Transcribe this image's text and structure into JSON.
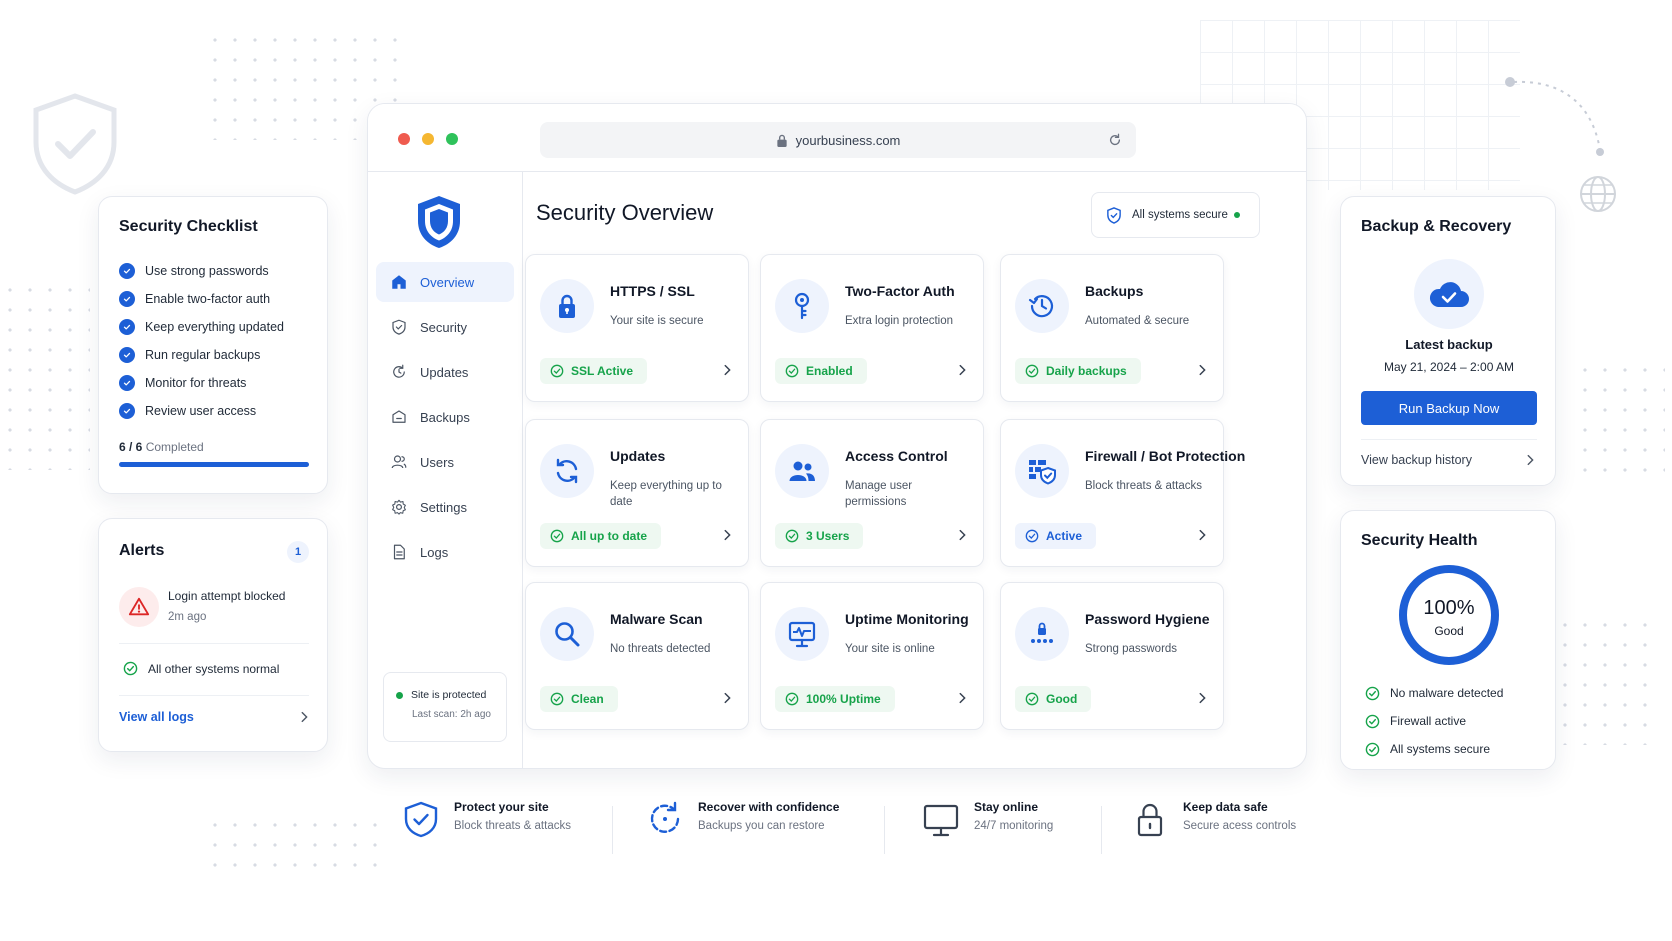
{
  "browser": {
    "url": "yourbusiness.com"
  },
  "sidebar": {
    "items": [
      {
        "label": "Overview",
        "icon": "home-icon",
        "active": true
      },
      {
        "label": "Security",
        "icon": "shield-icon"
      },
      {
        "label": "Updates",
        "icon": "refresh-icon"
      },
      {
        "label": "Backups",
        "icon": "box-icon"
      },
      {
        "label": "Users",
        "icon": "user-icon"
      },
      {
        "label": "Settings",
        "icon": "gear-icon"
      },
      {
        "label": "Logs",
        "icon": "document-icon"
      }
    ],
    "status": {
      "title": "Site is protected",
      "subtitle": "Last scan: 2h ago"
    }
  },
  "main": {
    "title": "Security Overview",
    "status_badge": "All systems secure",
    "tiles": [
      {
        "title": "HTTPS / SSL",
        "subtitle": "Your site is secure",
        "pill": "SSL Active",
        "icon": "lock-icon"
      },
      {
        "title": "Two-Factor Auth",
        "subtitle": "Extra login protection",
        "pill": "Enabled",
        "icon": "key-icon"
      },
      {
        "title": "Backups",
        "subtitle": "Automated & secure",
        "pill": "Daily backups",
        "icon": "history-icon"
      },
      {
        "title": "Updates",
        "subtitle": "Keep everything up to date",
        "pill": "All up to date",
        "icon": "sync-icon"
      },
      {
        "title": "Access Control",
        "subtitle": "Manage user permissions",
        "pill": "3 Users",
        "icon": "users-icon"
      },
      {
        "title": "Firewall / Bot Protection",
        "subtitle": "Block threats & attacks",
        "pill": "Active",
        "icon": "firewall-icon"
      },
      {
        "title": "Malware Scan",
        "subtitle": "No threats detected",
        "pill": "Clean",
        "icon": "search-icon"
      },
      {
        "title": "Uptime Monitoring",
        "subtitle": "Your site is online",
        "pill": "100% Uptime",
        "icon": "monitor-icon"
      },
      {
        "title": "Password Hygiene",
        "subtitle": "Strong passwords",
        "pill": "Good",
        "icon": "password-icon"
      }
    ]
  },
  "checklist": {
    "title": "Security Checklist",
    "items": [
      "Use strong passwords",
      "Enable two-factor auth",
      "Keep everything updated",
      "Run regular backups",
      "Monitor for threats",
      "Review user access"
    ],
    "progress_count": "6 / 6",
    "progress_label": "Completed",
    "progress": 1.0
  },
  "alerts": {
    "title": "Alerts",
    "count": "1",
    "alert_title": "Login attempt blocked",
    "alert_time": "2m ago",
    "normal": "All other systems normal",
    "link": "View all logs"
  },
  "backup": {
    "title": "Backup & Recovery",
    "latest_label": "Latest backup",
    "latest_date": "May 21, 2024 – 2:00 AM",
    "button": "Run Backup Now",
    "history_link": "View backup history"
  },
  "health": {
    "title": "Security Health",
    "percent": "100%",
    "label": "Good",
    "value": 1.0,
    "items": [
      "No malware detected",
      "Firewall active",
      "All systems secure"
    ]
  },
  "features": [
    {
      "title": "Protect your site",
      "subtitle": "Block threats & attacks",
      "icon": "shield-check-icon"
    },
    {
      "title": "Recover with confidence",
      "subtitle": "Backups you can restore",
      "icon": "restore-icon"
    },
    {
      "title": "Stay online",
      "subtitle": "24/7 monitoring",
      "icon": "monitor-icon"
    },
    {
      "title": "Keep data safe",
      "subtitle": "Secure acess controls",
      "icon": "padlock-icon"
    }
  ],
  "colors": {
    "accent": "#1d5fd6",
    "success": "#16a34a",
    "danger": "#dc2626"
  }
}
